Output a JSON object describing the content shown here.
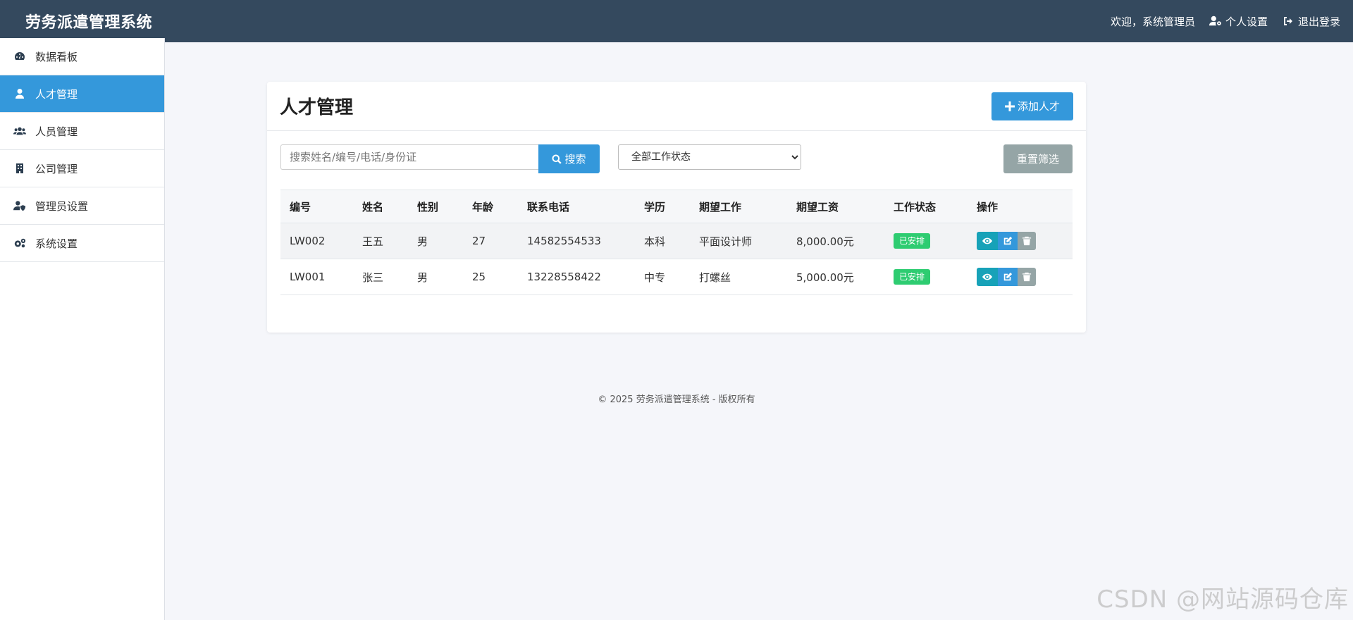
{
  "header": {
    "app_title": "劳务派遣管理系统",
    "welcome": "欢迎，系统管理员",
    "profile_label": "个人设置",
    "logout_label": "退出登录"
  },
  "sidebar": {
    "items": [
      {
        "label": "数据看板",
        "icon": "dashboard-icon",
        "active": false
      },
      {
        "label": "人才管理",
        "icon": "user-tie-icon",
        "active": true
      },
      {
        "label": "人员管理",
        "icon": "users-icon",
        "active": false
      },
      {
        "label": "公司管理",
        "icon": "building-icon",
        "active": false
      },
      {
        "label": "管理员设置",
        "icon": "user-shield-icon",
        "active": false
      },
      {
        "label": "系统设置",
        "icon": "cogs-icon",
        "active": false
      }
    ]
  },
  "main": {
    "title": "人才管理",
    "add_label": "添加人才",
    "search_placeholder": "搜索姓名/编号/电话/身份证",
    "search_label": "搜索",
    "status_select_value": "全部工作状态",
    "reset_label": "重置筛选",
    "columns": [
      "编号",
      "姓名",
      "性别",
      "年龄",
      "联系电话",
      "学历",
      "期望工作",
      "期望工资",
      "工作状态",
      "操作"
    ],
    "rows": [
      {
        "id": "LW002",
        "name": "王五",
        "gender": "男",
        "age": "27",
        "phone": "14582554533",
        "education": "本科",
        "job": "平面设计师",
        "salary": "8,000.00元",
        "status": "已安排"
      },
      {
        "id": "LW001",
        "name": "张三",
        "gender": "男",
        "age": "25",
        "phone": "13228558422",
        "education": "中专",
        "job": "打螺丝",
        "salary": "5,000.00元",
        "status": "已安排"
      }
    ]
  },
  "footer": {
    "text": "© 2025 劳务派遣管理系统 - 版权所有"
  },
  "watermark": "CSDN @网站源码仓库",
  "colors": {
    "header_bg": "#34495e",
    "primary": "#3498db",
    "active_nav": "#3498db",
    "success_badge": "#2ecc71",
    "view_btn": "#17a2b8",
    "delete_btn": "#95a5a6",
    "page_bg": "#f5f6fa"
  }
}
